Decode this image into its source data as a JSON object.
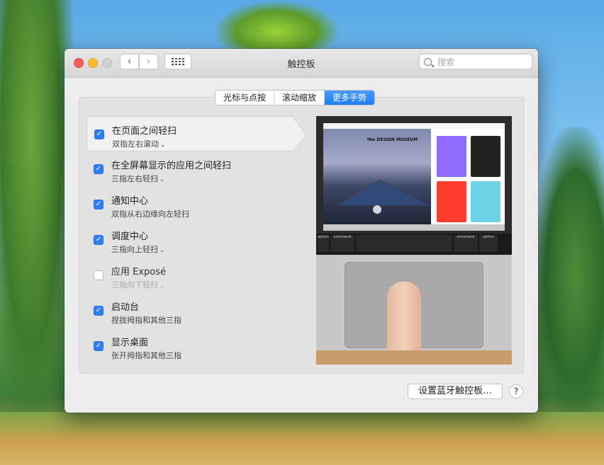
{
  "window": {
    "title": "触控板"
  },
  "search": {
    "placeholder": "搜索"
  },
  "tabs": [
    {
      "label": "光标与点按",
      "active": false
    },
    {
      "label": "滚动缩放",
      "active": false
    },
    {
      "label": "更多手势",
      "active": true
    }
  ],
  "gestures": [
    {
      "title": "在页面之间轻扫",
      "subtitle": "双指左右滚动",
      "checked": true,
      "dropdown": true,
      "selected": true
    },
    {
      "title": "在全屏幕显示的应用之间轻扫",
      "subtitle": "三指左右轻扫",
      "checked": true,
      "dropdown": true
    },
    {
      "title": "通知中心",
      "subtitle": "双指从右边缘向左轻扫",
      "checked": true,
      "dropdown": false
    },
    {
      "title": "调度中心",
      "subtitle": "三指向上轻扫",
      "checked": true,
      "dropdown": true
    },
    {
      "title": "应用 Exposé",
      "subtitle": "三指向下轻扫",
      "checked": false,
      "dropdown": true
    },
    {
      "title": "启动台",
      "subtitle": "捏拢拇指和其他三指",
      "checked": true,
      "dropdown": false
    },
    {
      "title": "显示桌面",
      "subtitle": "张开拇指和其他三指",
      "checked": true,
      "dropdown": false
    }
  ],
  "preview": {
    "logo": "the DESIGN MUSEUM",
    "keys": {
      "option_left": "option",
      "command_left": "command",
      "command_right": "command",
      "option_right": "option"
    }
  },
  "buttons": {
    "bluetooth": "设置蓝牙触控板…",
    "help": "?"
  },
  "colors": {
    "accent": "#2e7ff6",
    "close": "#ff5f57",
    "minimize": "#febc2e"
  }
}
